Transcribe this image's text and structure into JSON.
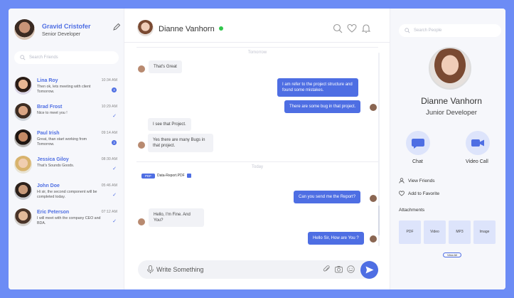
{
  "me": {
    "name": "Gravid Cristofer",
    "role": "Senior Developer"
  },
  "left_search": {
    "placeholder": "Search Friends"
  },
  "friends": [
    {
      "name": "Lina Roy",
      "preview": "Then ok, lets meeting with client Tomorrow.",
      "time": "10:34 AM",
      "badge": "3"
    },
    {
      "name": "Brad Frost",
      "preview": "Nice to meet you !",
      "time": "10:29 AM"
    },
    {
      "name": "Paul Irish",
      "preview": "Great, than start working from Tomorrow.",
      "time": "09:14 AM",
      "badge": "3"
    },
    {
      "name": "Jessica Giloy",
      "preview": "That's Sounds Goods.",
      "time": "08:30 AM"
    },
    {
      "name": "John Doe",
      "preview": "Hi sir, the second component will be completed today.",
      "time": "05:46 AM"
    },
    {
      "name": "Eric Peterson",
      "preview": "I will meet with the company CEO and BDA.",
      "time": "07:12 AM"
    }
  ],
  "chat": {
    "contact_name": "Dianne Vanhorn",
    "divider_tomorrow": "Tomorrow",
    "divider_today": "Today",
    "messages": {
      "m1": "That's Great",
      "m2": "I am refer to the project structure and found some mistakes.",
      "m3": "There are some bug in that project.",
      "m4": "I see that Project.",
      "m5": "Yes there are many Bugs in that project.",
      "m6": "Can you send me the Report?",
      "m7": "Hello, I'm Fine. And You?",
      "m8": "Hello Sir, How are You ?"
    },
    "file": {
      "type": "PDF",
      "name": "Data-Report.PDF"
    },
    "compose_placeholder": "Write Something"
  },
  "right_search": {
    "placeholder": "Search People"
  },
  "profile": {
    "name": "Dianne Vanhorn",
    "role": "Junior Developer",
    "chat_label": "Chat",
    "video_label": "Video Call",
    "view_friends": "View Friends",
    "add_favorite": "Add to Favorite",
    "attachments_title": "Attachments",
    "attachments": [
      "PDF",
      "Video",
      "MP3",
      "Image"
    ],
    "view_all": "View All"
  },
  "colors": {
    "accent": "#4e6ee3",
    "frame": "#6c8cf5",
    "online": "#31c64c",
    "tile": "#dde4fb"
  }
}
